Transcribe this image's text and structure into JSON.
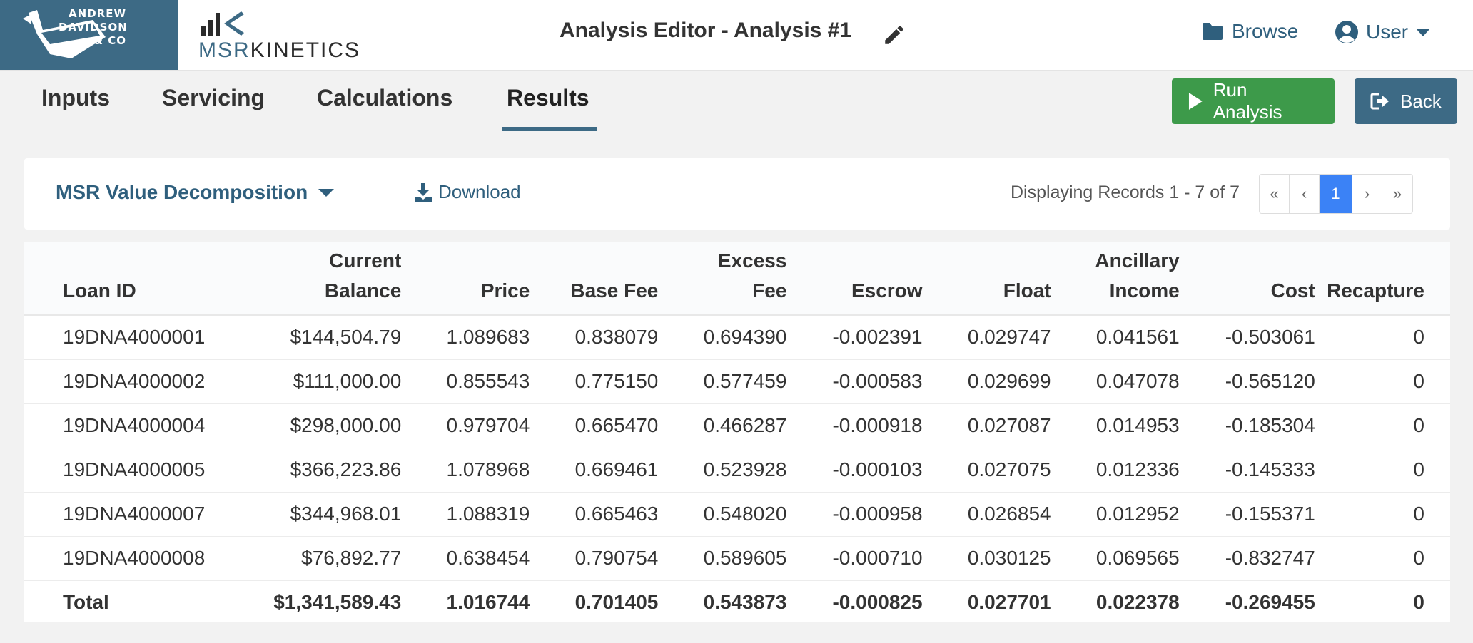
{
  "brand": {
    "ad_line1": "ANDREW",
    "ad_line2": "DAVIDSON",
    "ad_line3": "& CO",
    "msr_prefix": "MSR",
    "msr_suffix": "KINETICS"
  },
  "header": {
    "title": "Analysis Editor - Analysis #1",
    "browse_label": "Browse",
    "user_label": "User"
  },
  "tabs": [
    {
      "label": "Inputs"
    },
    {
      "label": "Servicing"
    },
    {
      "label": "Calculations"
    },
    {
      "label": "Results",
      "active": true
    }
  ],
  "actions": {
    "run_label": "Run Analysis",
    "back_label": "Back"
  },
  "toolbar": {
    "report": "MSR Value Decomposition",
    "download_label": "Download",
    "records_text": "Displaying Records 1 - 7 of 7",
    "pager": {
      "first": "«",
      "prev": "‹",
      "current": "1",
      "next": "›",
      "last": "»"
    }
  },
  "table": {
    "headers": [
      [
        "",
        "Loan ID"
      ],
      [
        "Current",
        "Balance"
      ],
      [
        "",
        "Price"
      ],
      [
        "",
        "Base Fee"
      ],
      [
        "Excess",
        "Fee"
      ],
      [
        "",
        "Escrow"
      ],
      [
        "",
        "Float"
      ],
      [
        "Ancillary",
        "Income"
      ],
      [
        "",
        "Cost"
      ],
      [
        "",
        "Recapture"
      ]
    ],
    "rows": [
      [
        "19DNA4000001",
        "$144,504.79",
        "1.089683",
        "0.838079",
        "0.694390",
        "-0.002391",
        "0.029747",
        "0.041561",
        "-0.503061",
        "0"
      ],
      [
        "19DNA4000002",
        "$111,000.00",
        "0.855543",
        "0.775150",
        "0.577459",
        "-0.000583",
        "0.029699",
        "0.047078",
        "-0.565120",
        "0"
      ],
      [
        "19DNA4000004",
        "$298,000.00",
        "0.979704",
        "0.665470",
        "0.466287",
        "-0.000918",
        "0.027087",
        "0.014953",
        "-0.185304",
        "0"
      ],
      [
        "19DNA4000005",
        "$366,223.86",
        "1.078968",
        "0.669461",
        "0.523928",
        "-0.000103",
        "0.027075",
        "0.012336",
        "-0.145333",
        "0"
      ],
      [
        "19DNA4000007",
        "$344,968.01",
        "1.088319",
        "0.665463",
        "0.548020",
        "-0.000958",
        "0.026854",
        "0.012952",
        "-0.155371",
        "0"
      ],
      [
        "19DNA4000008",
        "$76,892.77",
        "0.638454",
        "0.790754",
        "0.589605",
        "-0.000710",
        "0.030125",
        "0.069565",
        "-0.832747",
        "0"
      ],
      [
        "Total",
        "$1,341,589.43",
        "1.016744",
        "0.701405",
        "0.543873",
        "-0.000825",
        "0.027701",
        "0.022378",
        "-0.269455",
        "0"
      ]
    ]
  },
  "colors": {
    "brand_blue": "#3d6a85",
    "link_blue": "#2f5f7d",
    "run_green": "#3d9a4a",
    "pager_active": "#3b82f6"
  }
}
